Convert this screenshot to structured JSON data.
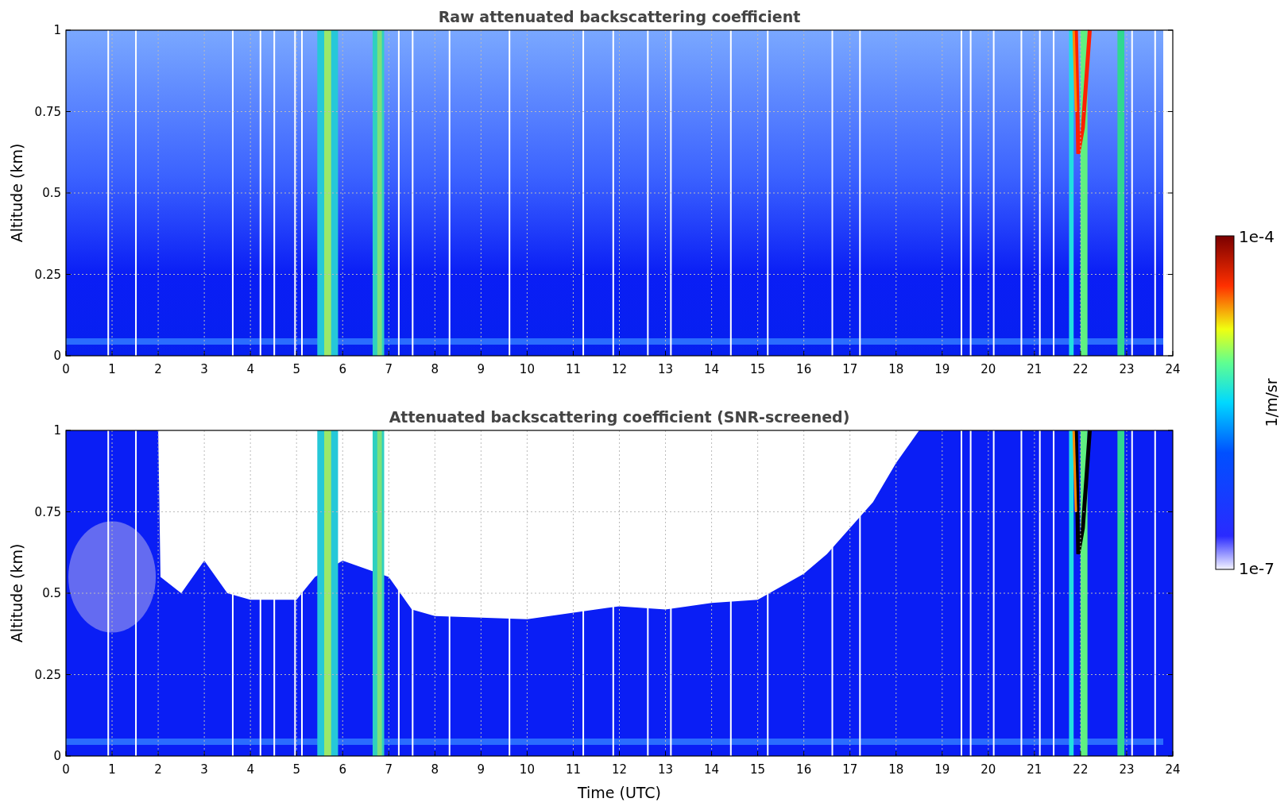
{
  "figure": {
    "panels": [
      {
        "title": "Raw attenuated backscattering coefficient",
        "ylabel": "Altitude (km)",
        "yticks": [
          "1",
          "0.75",
          "0.5",
          "0.25",
          "0"
        ],
        "xticks": [
          "0",
          "1",
          "2",
          "3",
          "4",
          "5",
          "6",
          "7",
          "8",
          "9",
          "10",
          "11",
          "12",
          "13",
          "14",
          "15",
          "16",
          "17",
          "18",
          "19",
          "20",
          "21",
          "22",
          "23",
          "24"
        ],
        "screened": false
      },
      {
        "title": "Attenuated backscattering coefficient (SNR-screened)",
        "ylabel": "Altitude (km)",
        "yticks": [
          "1",
          "0.75",
          "0.5",
          "0.25",
          "0"
        ],
        "xticks": [
          "0",
          "1",
          "2",
          "3",
          "4",
          "5",
          "6",
          "7",
          "8",
          "9",
          "10",
          "11",
          "12",
          "13",
          "14",
          "15",
          "16",
          "17",
          "18",
          "19",
          "20",
          "21",
          "22",
          "23",
          "24"
        ],
        "screened": true
      }
    ],
    "xlabel": "Time (UTC)",
    "colorbar": {
      "max_label": "1e-4",
      "min_label": "1e-7",
      "label": "1/m/sr"
    }
  }
}
